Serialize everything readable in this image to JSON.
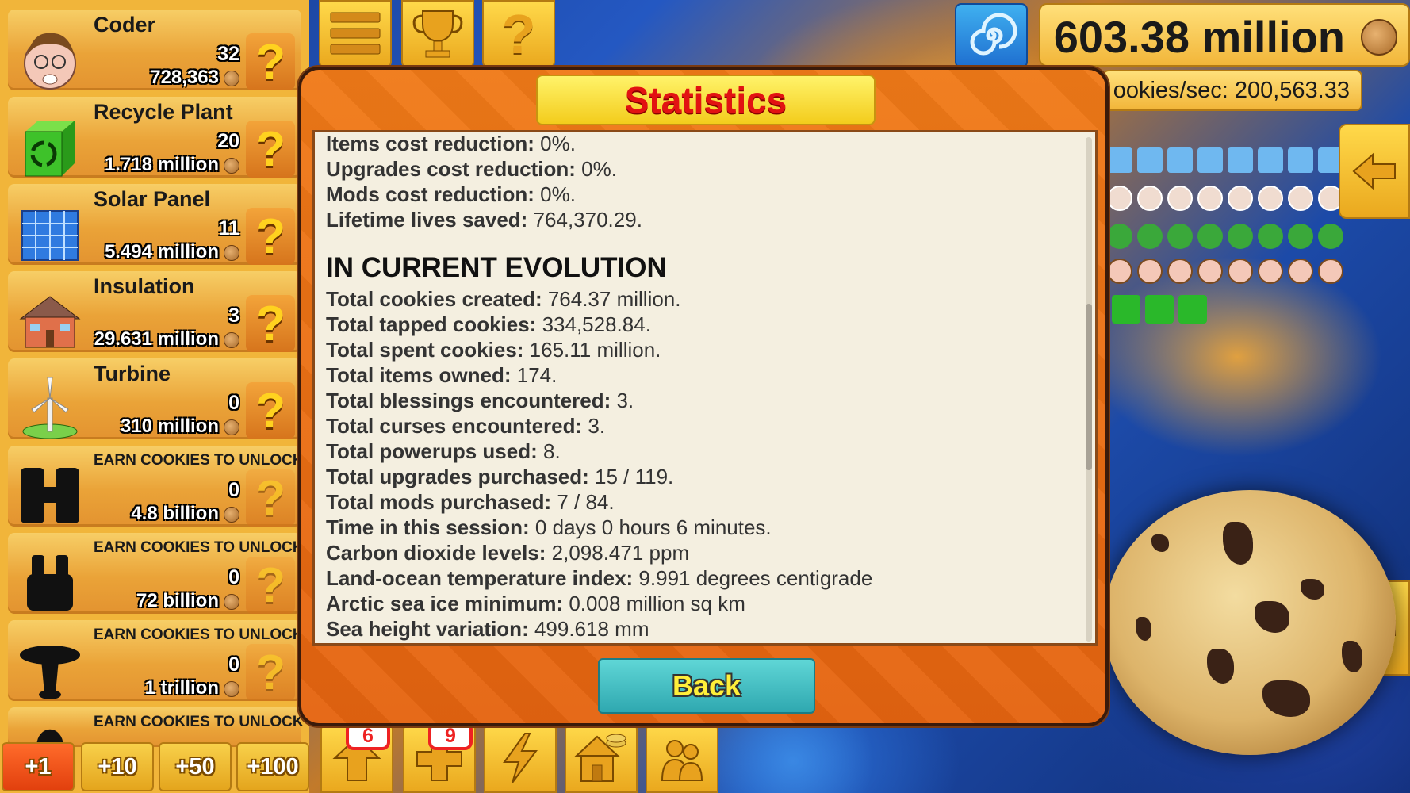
{
  "header": {
    "cookie_total": "603.38 million",
    "cookies_per_sec": "ookies/sec: 200,563.33"
  },
  "items": [
    {
      "name": "Coder",
      "count": "32",
      "price": "728,363",
      "icon": "coder-face-icon"
    },
    {
      "name": "Recycle Plant",
      "count": "20",
      "price": "1.718 million",
      "icon": "recycle-cube-icon"
    },
    {
      "name": "Solar Panel",
      "count": "11",
      "price": "5.494 million",
      "icon": "solar-panel-icon"
    },
    {
      "name": "Insulation",
      "count": "3",
      "price": "29.631 million",
      "icon": "house-icon"
    },
    {
      "name": "Turbine",
      "count": "0",
      "price": "310 million",
      "icon": "wind-turbine-icon"
    },
    {
      "name": "EARN COOKIES TO UNLOCK",
      "count": "0",
      "price": "4.8 billion",
      "icon": "locked-silhouette-icon"
    },
    {
      "name": "EARN COOKIES TO UNLOCK",
      "count": "0",
      "price": "72 billion",
      "icon": "locked-silhouette-icon"
    },
    {
      "name": "EARN COOKIES TO UNLOCK",
      "count": "0",
      "price": "1 trillion",
      "icon": "locked-silhouette-icon"
    },
    {
      "name": "EARN COOKIES TO UNLOCK",
      "icon": "locked-silhouette-icon"
    }
  ],
  "buy_amounts": [
    "+1",
    "+10",
    "+50",
    "+100"
  ],
  "bottom_badges": {
    "upgrades": "6",
    "health": "9"
  },
  "modal": {
    "title": "Statistics",
    "back_label": "Back",
    "top_stats": [
      {
        "label": "Items cost reduction:",
        "value": " 0%."
      },
      {
        "label": "Upgrades cost reduction:",
        "value": " 0%."
      },
      {
        "label": "Mods cost reduction:",
        "value": " 0%."
      },
      {
        "label": "Lifetime lives saved:",
        "value": " 764,370.29."
      }
    ],
    "section_title": "IN CURRENT EVOLUTION",
    "stats": [
      {
        "label": "Total cookies created:",
        "value": " 764.37 million."
      },
      {
        "label": "Total tapped cookies:",
        "value": " 334,528.84."
      },
      {
        "label": "Total spent cookies:",
        "value": " 165.11 million."
      },
      {
        "label": "Total items owned:",
        "value": " 174."
      },
      {
        "label": "Total blessings encountered:",
        "value": " 3."
      },
      {
        "label": "Total curses encountered:",
        "value": " 3."
      },
      {
        "label": "Total powerups used:",
        "value": " 8."
      },
      {
        "label": "Total upgrades purchased:",
        "value": " 15 / 119."
      },
      {
        "label": "Total mods purchased:",
        "value": " 7 / 84."
      },
      {
        "label": "Time in this session:",
        "value": " 0 days 0 hours 6 minutes."
      },
      {
        "label": "Carbon dioxide levels:",
        "value": " 2,098.471 ppm"
      },
      {
        "label": "Land-ocean temperature index:",
        "value": " 9.991 degrees centigrade"
      },
      {
        "label": "Arctic sea ice minimum:",
        "value": " 0.008 million sq km"
      },
      {
        "label": "Sea height variation:",
        "value": " 499.618 mm"
      }
    ]
  }
}
